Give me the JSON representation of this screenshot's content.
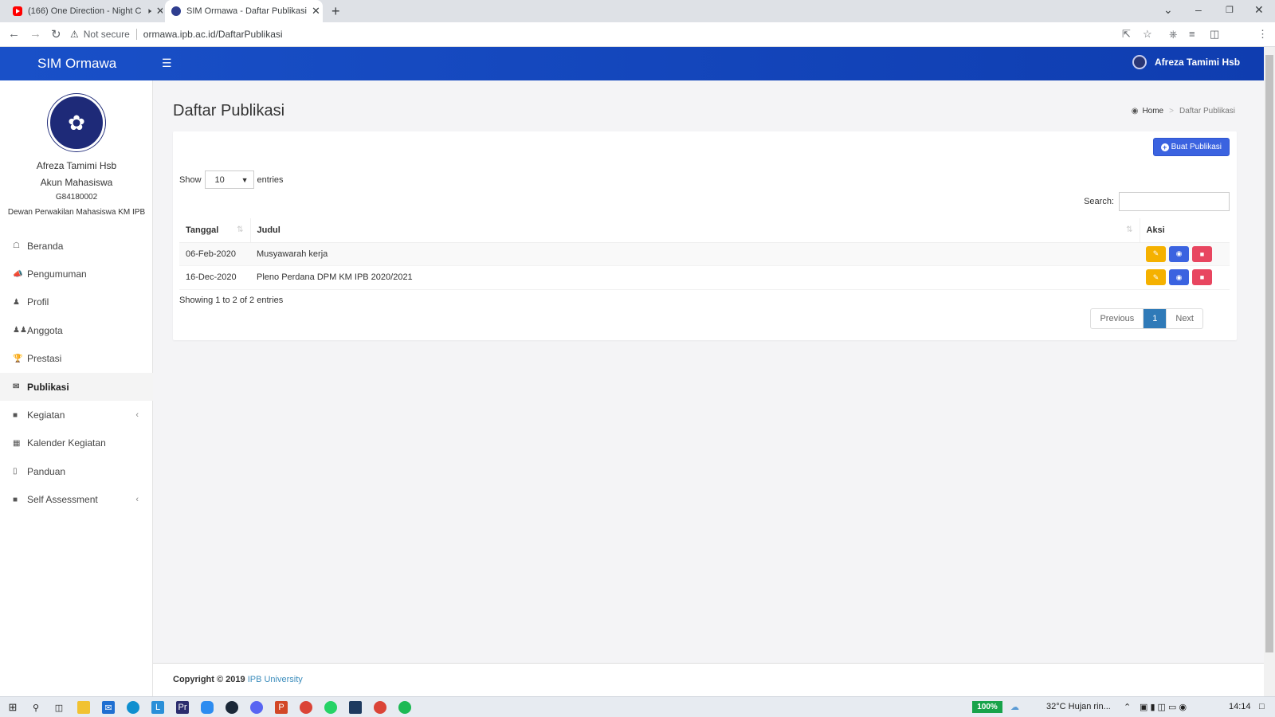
{
  "browser": {
    "tabs": [
      {
        "title": "(166) One Direction - Night C",
        "icon": "youtube-icon"
      },
      {
        "title": "SIM Ormawa - Daftar Publikasi",
        "icon": "ipb-icon"
      }
    ],
    "security_label": "Not secure",
    "url": "ormawa.ipb.ac.id/DaftarPublikasi"
  },
  "app": {
    "brand": "SIM Ormawa",
    "header_user": "Afreza Tamimi Hsb"
  },
  "sidebar": {
    "name": "Afreza Tamimi Hsb",
    "role": "Akun Mahasiswa",
    "nim": "G84180002",
    "org": "Dewan Perwakilan Mahasiswa KM IPB",
    "items": [
      {
        "label": "Beranda",
        "icon": "home-icon"
      },
      {
        "label": "Pengumuman",
        "icon": "bullhorn-icon"
      },
      {
        "label": "Profil",
        "icon": "user-icon"
      },
      {
        "label": "Anggota",
        "icon": "users-icon"
      },
      {
        "label": "Prestasi",
        "icon": "trophy-icon"
      },
      {
        "label": "Publikasi",
        "icon": "comments-icon"
      },
      {
        "label": "Kegiatan",
        "icon": "folder-icon"
      },
      {
        "label": "Kalender Kegiatan",
        "icon": "calendar-icon"
      },
      {
        "label": "Panduan",
        "icon": "book-icon"
      },
      {
        "label": "Self Assessment",
        "icon": "folder-icon"
      }
    ]
  },
  "page": {
    "title": "Daftar Publikasi",
    "breadcrumb_home": "Home",
    "breadcrumb_current": "Daftar Publikasi",
    "create_button": "Buat Publikasi",
    "show_label": "Show",
    "entries_value": "10",
    "entries_label": "entries",
    "search_label": "Search:",
    "columns": [
      "Tanggal",
      "Judul",
      "Aksi"
    ],
    "rows": [
      {
        "tanggal": "06-Feb-2020",
        "judul": "Musyawarah kerja"
      },
      {
        "tanggal": "16-Dec-2020",
        "judul": "Pleno Perdana DPM KM IPB 2020/2021"
      }
    ],
    "info": "Showing 1 to 2 of 2 entries",
    "pager": {
      "previous": "Previous",
      "current": "1",
      "next": "Next"
    },
    "footer_text": "Copyright © 2019",
    "footer_link": "IPB University"
  },
  "taskbar": {
    "battery": "100%",
    "weather": "32°C  Hujan rin...",
    "time": "14:14"
  },
  "colors": {
    "header": "#1950c8",
    "edit": "#f5b100",
    "view": "#3b63e0",
    "delete": "#e84660",
    "pager_active": "#2f7ab8"
  }
}
